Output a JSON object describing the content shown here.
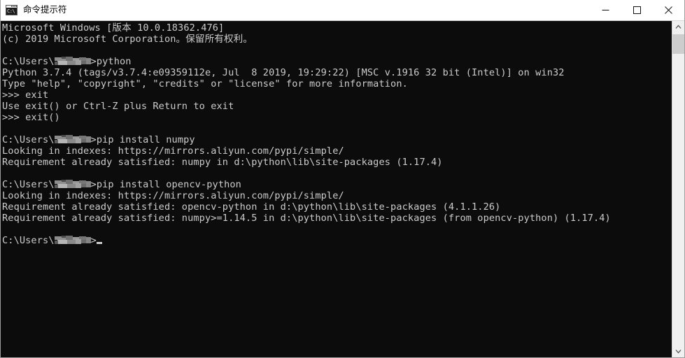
{
  "window": {
    "title": "命令提示符",
    "icon_text": "C:\\",
    "icon_name": "cmd-console-icon",
    "controls": {
      "minimize_label": "最小化",
      "maximize_label": "最大化",
      "close_label": "关闭"
    }
  },
  "console": {
    "background_color": "#0c0c0c",
    "foreground_color": "#cccccc",
    "lines": [
      {
        "id": "l1",
        "text": "Microsoft Windows [版本 10.0.18362.476]"
      },
      {
        "id": "l2",
        "text": "(c) 2019 Microsoft Corporation。保留所有权利。"
      },
      {
        "id": "l3",
        "text": ""
      },
      {
        "id": "l4",
        "prompt": "C:\\Users\\",
        "redacted": true,
        "suffix": ">",
        "text": "python"
      },
      {
        "id": "l5",
        "text": "Python 3.7.4 (tags/v3.7.4:e09359112e, Jul  8 2019, 19:29:22) [MSC v.1916 32 bit (Intel)] on win32"
      },
      {
        "id": "l6",
        "text": "Type \"help\", \"copyright\", \"credits\" or \"license\" for more information."
      },
      {
        "id": "l7",
        "text": ">>> exit"
      },
      {
        "id": "l8",
        "text": "Use exit() or Ctrl-Z plus Return to exit"
      },
      {
        "id": "l9",
        "text": ">>> exit()"
      },
      {
        "id": "l10",
        "text": ""
      },
      {
        "id": "l11",
        "prompt": "C:\\Users\\",
        "redacted": true,
        "suffix": ">",
        "text": "pip install numpy"
      },
      {
        "id": "l12",
        "text": "Looking in indexes: https://mirrors.aliyun.com/pypi/simple/"
      },
      {
        "id": "l13",
        "text": "Requirement already satisfied: numpy in d:\\python\\lib\\site-packages (1.17.4)"
      },
      {
        "id": "l14",
        "text": ""
      },
      {
        "id": "l15",
        "prompt": "C:\\Users\\",
        "redacted": true,
        "suffix": ">",
        "text": "pip install opencv-python"
      },
      {
        "id": "l16",
        "text": "Looking in indexes: https://mirrors.aliyun.com/pypi/simple/"
      },
      {
        "id": "l17",
        "text": "Requirement already satisfied: opencv-python in d:\\python\\lib\\site-packages (4.1.1.26)"
      },
      {
        "id": "l18",
        "text": "Requirement already satisfied: numpy>=1.14.5 in d:\\python\\lib\\site-packages (from opencv-python) (1.17.4)"
      },
      {
        "id": "l19",
        "text": ""
      },
      {
        "id": "l20",
        "prompt": "C:\\Users\\",
        "redacted": true,
        "suffix": ">",
        "text": "",
        "cursor": true
      }
    ]
  },
  "scrollbar": {
    "up_arrow": "scroll-up",
    "down_arrow": "scroll-down",
    "thumb_top_percent": 1,
    "thumb_height_percent": 6
  }
}
